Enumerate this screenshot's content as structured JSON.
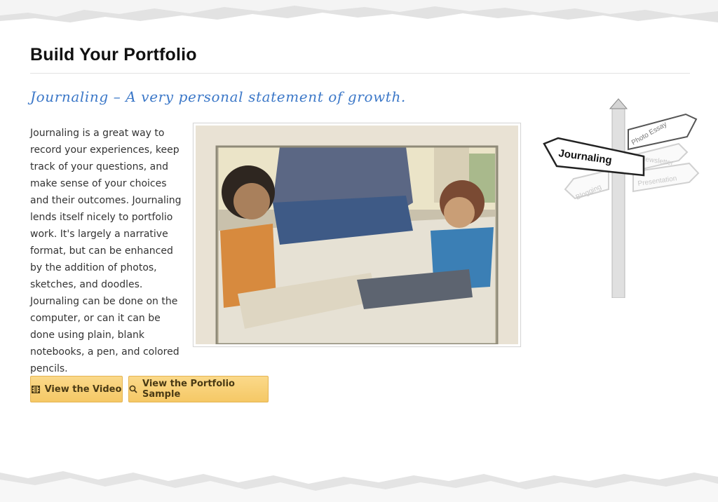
{
  "section": {
    "title": "Build Your Portfolio",
    "subtitle": "Journaling – A very personal statement of growth.",
    "body": "Journaling is a great way to record your experiences, keep track of your questions, and make sense of your choices and their outcomes. Journaling lends itself nicely to portfolio work. It's largely a narrative format, but can be enhanced by the addition of photos, sketches, and doodles. Journaling can be done on the computer, or can it can be done using plain, blank notebooks, a pen, and colored pencils."
  },
  "signpost": {
    "main_sign": "Journaling",
    "other_signs": [
      "Photo Essay",
      "Newsletter",
      "Blogging",
      "Presentation"
    ]
  },
  "buttons": {
    "video_label": "View the Video",
    "video_icon": "film-icon",
    "sample_label": "View the Portfolio Sample",
    "sample_icon": "search-icon"
  },
  "colors": {
    "subtitle": "#3c78c8",
    "button_bg": "#f5c866",
    "button_border": "#e4b453"
  }
}
